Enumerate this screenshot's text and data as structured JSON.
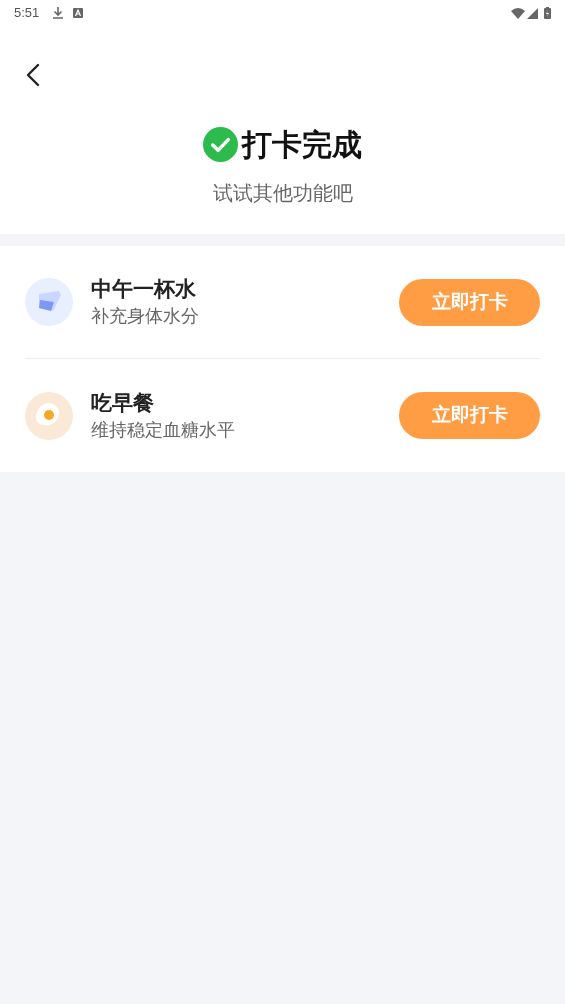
{
  "status_bar": {
    "time": "5:51"
  },
  "header": {
    "title": "打卡完成",
    "subtitle": "试试其他功能吧"
  },
  "tasks": [
    {
      "kind": "water",
      "title": "中午一杯水",
      "subtitle": "补充身体水分",
      "button": "立即打卡"
    },
    {
      "kind": "egg",
      "title": "吃早餐",
      "subtitle": "维持稳定血糖水平",
      "button": "立即打卡"
    }
  ]
}
